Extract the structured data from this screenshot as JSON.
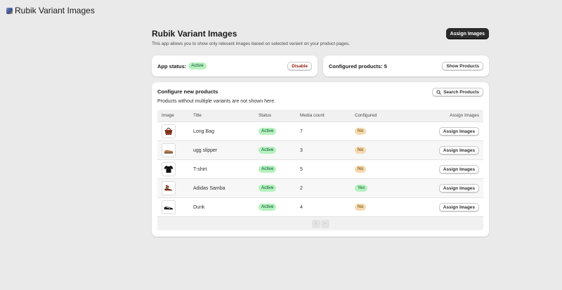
{
  "app": {
    "name": "Rubik Variant Images",
    "logo_icon": "app-logo-icon"
  },
  "header": {
    "title": "Rubik Variant Images",
    "subtitle": "This app allows you to show only relevant images based on selected variant on your product pages.",
    "primary_button": "Assign Images"
  },
  "status_card": {
    "label": "App status:",
    "badge": "Active",
    "button": "Disable"
  },
  "config_card": {
    "label": "Configured products: 5",
    "button": "Show Products"
  },
  "configure": {
    "title": "Configure new products",
    "subtitle": "Products without multiple variants are not shown here.",
    "search_button": "Search Products",
    "columns": [
      "Image",
      "Title",
      "Status",
      "Media count",
      "Configured",
      "Assign Images"
    ],
    "rows": [
      {
        "image": "bag-icon",
        "title": "Long Bag",
        "status": "Active",
        "media": "7",
        "configured": "No",
        "action": "Assign Images"
      },
      {
        "image": "slipper-icon",
        "title": "ugg slipper",
        "status": "Active",
        "media": "3",
        "configured": "No",
        "action": "Assign Images"
      },
      {
        "image": "tshirt-icon",
        "title": "T-shirt",
        "status": "Active",
        "media": "5",
        "configured": "No",
        "action": "Assign Images"
      },
      {
        "image": "sneaker-icon",
        "title": "Adidas Samba",
        "status": "Active",
        "media": "2",
        "configured": "Yes",
        "action": "Assign Images"
      },
      {
        "image": "shoe-icon",
        "title": "Dunk",
        "status": "Active",
        "media": "4",
        "configured": "No",
        "action": "Assign Images"
      }
    ],
    "pagination": {
      "prev": "‹",
      "next": "›"
    }
  },
  "colors": {
    "primary_button": "#2b2b2b",
    "active_badge": "#b5f2be",
    "no_badge": "#f7d9b0",
    "disable_text": "#8e1f0b",
    "background": "#eaeaea"
  }
}
